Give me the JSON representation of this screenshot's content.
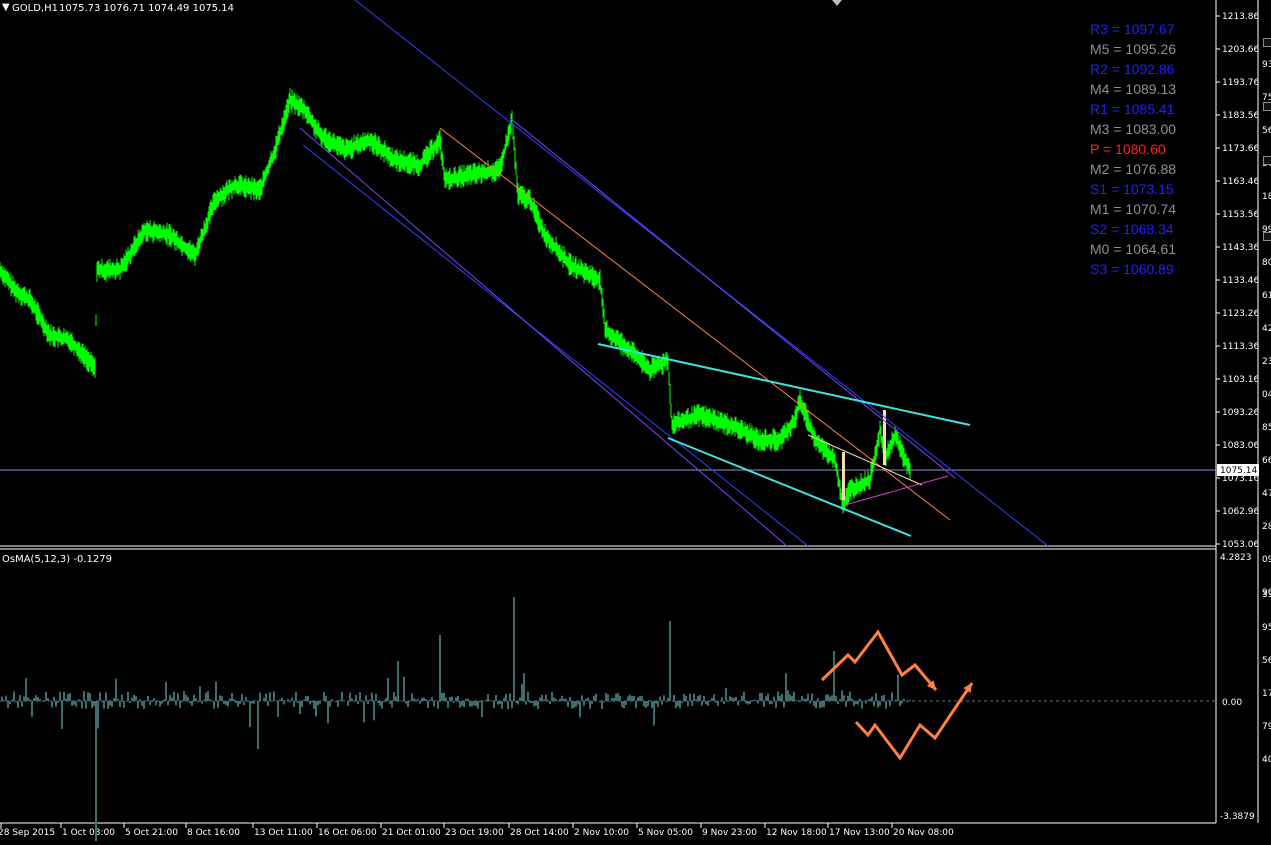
{
  "header": {
    "symbol": "GOLD,H1",
    "ohlc": "1075.73 1076.71 1074.49 1075.14",
    "indicator": "OsMA(5,12,3) -0.1279"
  },
  "price_axis": {
    "ticks": [
      "1213.86",
      "1203.66",
      "1193.76",
      "1183.56",
      "1173.66",
      "1163.46",
      "1153.56",
      "1143.36",
      "1133.46",
      "1123.26",
      "1113.36",
      "1103.16",
      "1093.26",
      "1083.06",
      "1073.16",
      "1062.96",
      "1053.06"
    ],
    "current_price": "1075.14"
  },
  "osma_axis": {
    "top": "4.2823",
    "zero": "0.00",
    "bottom": "-3.3879"
  },
  "time_axis": [
    "28 Sep 2015",
    "1 Oct 03:00",
    "5 Oct 21:00",
    "8 Oct 16:00",
    "13 Oct 11:00",
    "16 Oct 06:00",
    "21 Oct 01:00",
    "23 Oct 19:00",
    "28 Oct 14:00",
    "2 Nov 10:00",
    "5 Nov 05:00",
    "9 Nov 23:00",
    "12 Nov 18:00",
    "17 Nov 13:00",
    "20 Nov 08:00"
  ],
  "pivots": [
    {
      "label": "R3 = 1097.67",
      "color": "#2020ff"
    },
    {
      "label": "M5 = 1095.26",
      "color": "#909090"
    },
    {
      "label": "R2 = 1092.86",
      "color": "#2020ff"
    },
    {
      "label": "M4 = 1089.13",
      "color": "#909090"
    },
    {
      "label": "R1 = 1085.41",
      "color": "#2020ff"
    },
    {
      "label": "M3 = 1083.00",
      "color": "#909090"
    },
    {
      "label": "P   = 1080.60",
      "color": "#ff2020"
    },
    {
      "label": "M2 = 1076.88",
      "color": "#909090"
    },
    {
      "label": "S1 = 1073.15",
      "color": "#2020ff"
    },
    {
      "label": "M1 = 1070.74",
      "color": "#909090"
    },
    {
      "label": "S2 = 1068.34",
      "color": "#2020ff"
    },
    {
      "label": "M0 = 1064.61",
      "color": "#909090"
    },
    {
      "label": "S3 = 1060.89",
      "color": "#2020ff"
    }
  ],
  "right_strip": [
    "93",
    "75",
    "56",
    "37",
    "18",
    "99",
    "80",
    "61",
    "42",
    "23",
    "04",
    "85",
    "66",
    "47",
    "28",
    "09",
    "90"
  ],
  "right_strip2": [
    "33",
    "95",
    "56",
    "17",
    "79",
    "40"
  ],
  "colors": {
    "price": "#00ff00",
    "cyan": "#40e0e0",
    "blue": "#3040ff",
    "purple": "#8040ff",
    "orange": "#ff8040",
    "osma": "#3c6e6e"
  }
}
